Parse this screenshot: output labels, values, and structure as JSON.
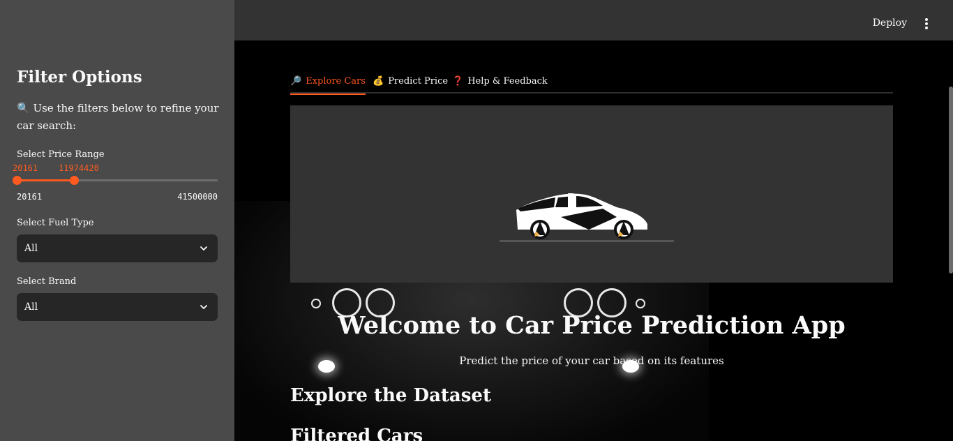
{
  "header": {
    "deploy_label": "Deploy",
    "menu_icon": "kebab-menu-icon"
  },
  "sidebar": {
    "title": "Filter Options",
    "help_icon": "magnifier-emoji",
    "help_text": "🔍 Use the filters below to refine your car search:",
    "price": {
      "label": "Select Price Range",
      "low": "20161",
      "high": "11974420",
      "min": "20161",
      "max": "41500000",
      "low_fraction": 0.0,
      "high_fraction": 0.288
    },
    "fuel": {
      "label": "Select Fuel Type",
      "value": "All"
    },
    "brand": {
      "label": "Select Brand",
      "value": "All"
    }
  },
  "tabs": [
    {
      "icon": "🔎",
      "label": "Explore Cars",
      "active": true
    },
    {
      "icon": "💰",
      "label": "Predict Price",
      "active": false
    },
    {
      "icon": "❓",
      "label": "Help & Feedback",
      "active": false
    }
  ],
  "main": {
    "welcome": "Welcome to Car Price Prediction App",
    "subtitle": "Predict the price of your car based on its features",
    "section1": "Explore the Dataset",
    "section2": "Filtered Cars"
  },
  "colors": {
    "accent": "#ff5a1f",
    "sidebar_bg": "#4a4a4a",
    "header_bg": "#333333",
    "select_bg": "#262626"
  }
}
